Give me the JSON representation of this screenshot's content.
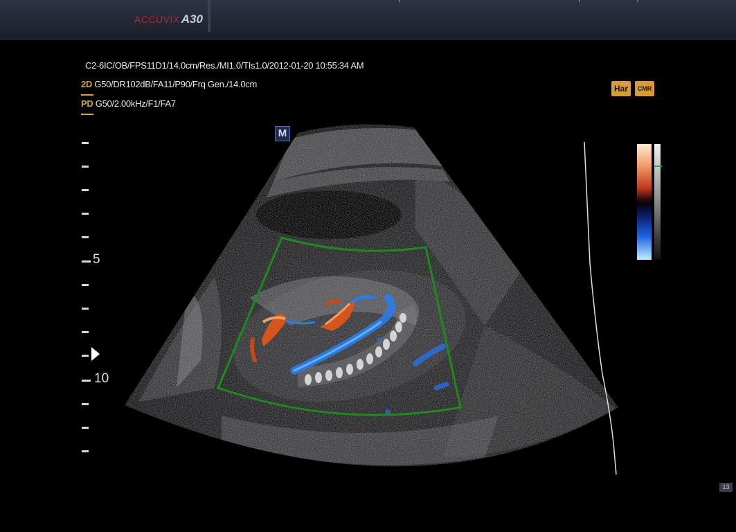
{
  "header": {
    "brand": "ACCUVIX",
    "model": "A30"
  },
  "info": {
    "line1": "C2-6IC/OB/FPS11D1/14.0cm/Res./MI1.0/TIs1.0/2012-01-20 10:55:34 AM",
    "mode_2d": "2D",
    "line2": "G50/DR102dB/FA11/P90/Frq Gen./14.0cm",
    "mode_pd": "PD",
    "line3": "G50/2.00kHz/F1/FA7"
  },
  "orientation_marker": "M",
  "depth_scale": {
    "label_5": "5",
    "label_10": "10"
  },
  "badges": {
    "harmonic": "Har",
    "cmr": "CMR"
  },
  "colors": {
    "roi_box": "#1d8a1d",
    "mode_label": "#d4a250",
    "flow_red": "#d4561c",
    "flow_blue": "#2a7ce8"
  },
  "frame_number": "13"
}
